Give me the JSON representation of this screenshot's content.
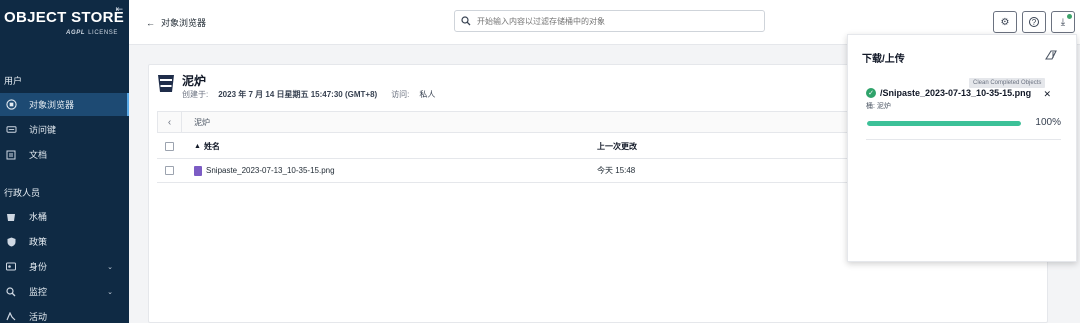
{
  "sidebar": {
    "logo_main": "OBJECT STORE",
    "logo_agpl": "AGPL",
    "logo_license": "LICENSE",
    "collapse_icon": "collapse-icon",
    "section_user": "用户",
    "section_admin": "行政人员",
    "user_items": [
      {
        "label": "对象浏览器",
        "icon": "browser-icon",
        "active": true
      },
      {
        "label": "访问键",
        "icon": "key-icon"
      },
      {
        "label": "文档",
        "icon": "docs-icon"
      }
    ],
    "admin_items": [
      {
        "label": "水桶",
        "icon": "bucket-icon"
      },
      {
        "label": "政策",
        "icon": "policy-icon"
      },
      {
        "label": "身份",
        "icon": "identity-icon",
        "has_chevron": true
      },
      {
        "label": "监控",
        "icon": "monitor-icon",
        "has_chevron": true
      },
      {
        "label": "活动",
        "icon": "activity-icon"
      }
    ]
  },
  "header": {
    "back_label": "对象浏览器",
    "search_placeholder": "开始输入内容以过滤存储桶中的对象"
  },
  "bucket": {
    "name": "泥炉",
    "created_label": "创建于:",
    "created_value": "2023 年 7 月 14 日星期五 15:47:30 (GMT+8)",
    "access_label": "访问:",
    "access_value": "私人",
    "path": "泥炉"
  },
  "table": {
    "col_name": "姓名",
    "col_modified": "上一次更改",
    "rows": [
      {
        "name": "Snipaste_2023-07-13_10-35-15.png",
        "modified": "今天 15:48"
      }
    ]
  },
  "downloads": {
    "title": "下载/上传",
    "tooltip": "Clean Completed Objects",
    "items": [
      {
        "name": "/Snipaste_2023-07-13_10-35-15.png",
        "bucket": "桶: 泥炉",
        "progress_percent": 100,
        "progress_label": "100%"
      }
    ]
  },
  "colors": {
    "sidebar_bg": "#0f2a44",
    "progress": "#3cc198",
    "success": "#2fa36b"
  }
}
